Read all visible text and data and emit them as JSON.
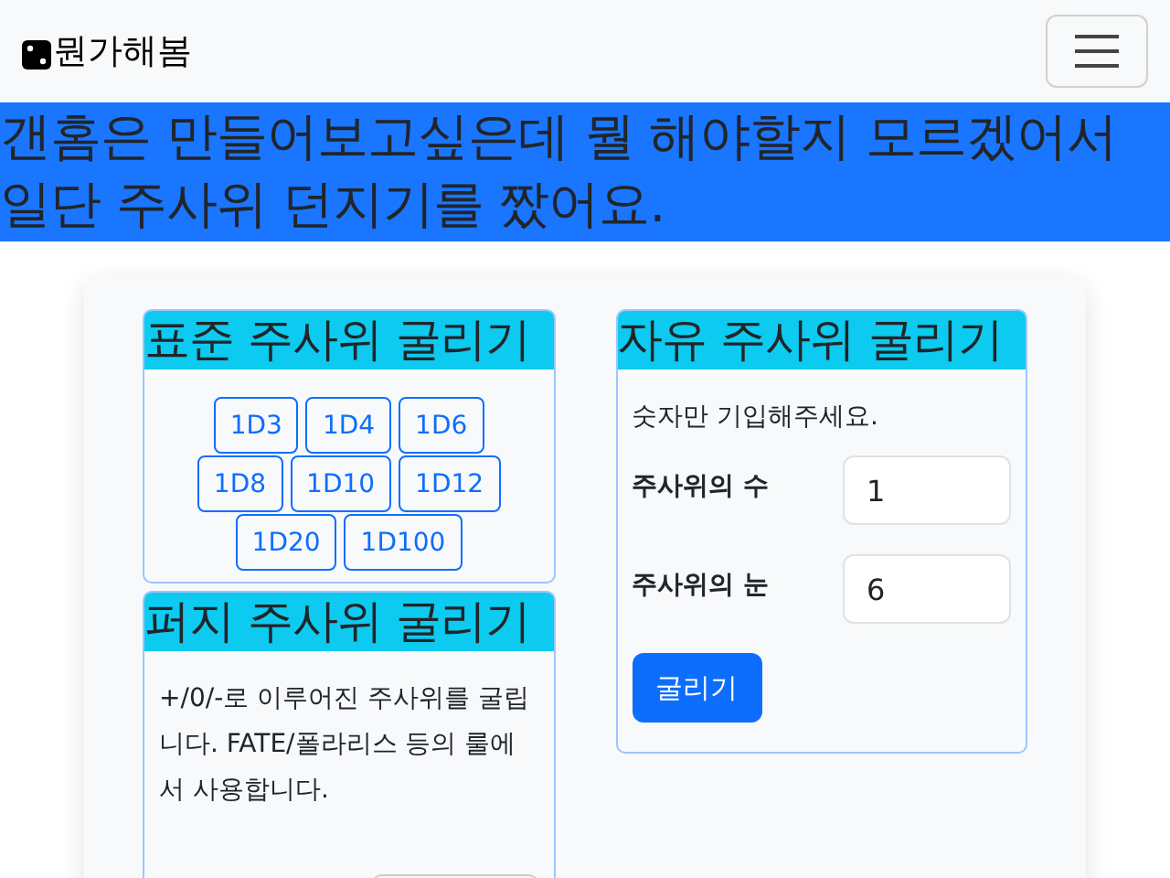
{
  "navbar": {
    "brand": "뭔가해봄"
  },
  "banner": {
    "text": "갠홈은 만들어보고싶은데 뭘 해야할지 모르겠어서 일단 주사위 던지기를 짰어요."
  },
  "standard": {
    "title": "표준 주사위 굴리기",
    "dice": [
      "1D3",
      "1D4",
      "1D6",
      "1D8",
      "1D10",
      "1D12",
      "1D20",
      "1D100"
    ]
  },
  "fudge": {
    "title": "퍼지 주사위 굴리기",
    "description": "+/0/-로 이루어진 주사위를 굴립니다. FATE/폴라리스 등의 룰에서 사용합니다."
  },
  "free": {
    "title": "자유 주사위 굴리기",
    "hint": "숫자만 기입해주세요.",
    "fields": [
      {
        "label": "주사위의 수",
        "value": "1"
      },
      {
        "label": "주사위의 눈",
        "value": "6"
      }
    ],
    "button": "굴리기"
  }
}
